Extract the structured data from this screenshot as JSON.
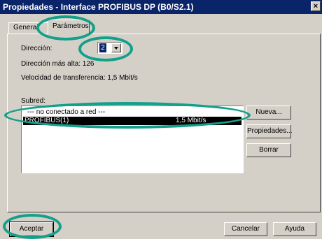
{
  "window": {
    "title": "Propiedades - Interface PROFIBUS  DP (B0/S2.1)",
    "close_glyph": "×"
  },
  "tabs": [
    {
      "label": "General"
    },
    {
      "label": "Parámetros"
    }
  ],
  "params": {
    "direccion_label": "Dirección:",
    "direccion_value": "2",
    "max_label": "Dirección más alta: 126",
    "speed_label": "Velocidad de transferencia: 1,5 Mbit/s",
    "subred_label": "Subred:"
  },
  "subnet_list": [
    {
      "name": "--- no conectado a red ---",
      "rate": ""
    },
    {
      "name": "PROFIBUS(1)",
      "rate": "1,5 Mbit/s"
    }
  ],
  "side_buttons": {
    "nueva": "Nueva...",
    "propiedades": "Propiedades...",
    "borrar": "Borrar"
  },
  "footer": {
    "aceptar": "Aceptar",
    "cancelar": "Cancelar",
    "ayuda": "Ayuda"
  },
  "colors": {
    "highlight_ring": "#13a08a",
    "titlebar": "#0a246a",
    "dialog_bg": "#d4d0c8"
  }
}
